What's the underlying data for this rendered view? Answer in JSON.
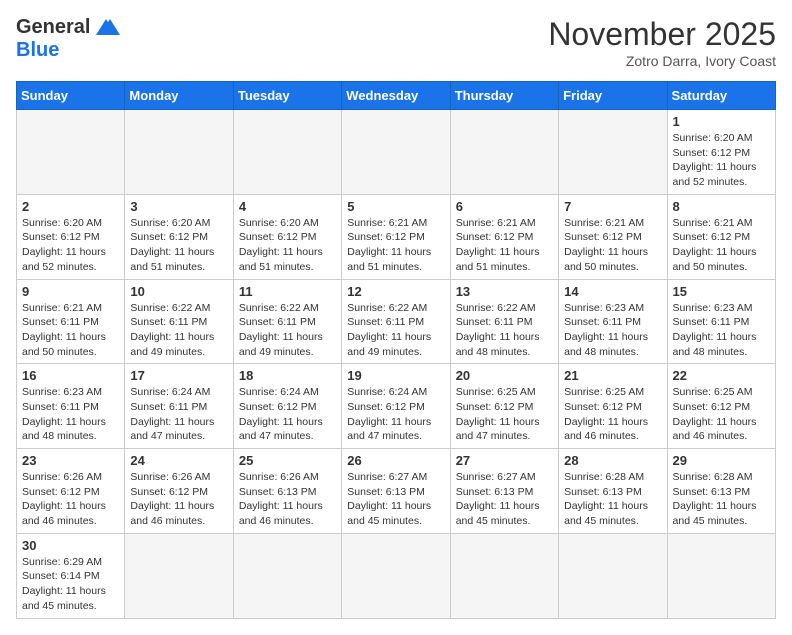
{
  "header": {
    "logo_general": "General",
    "logo_blue": "Blue",
    "month": "November 2025",
    "location": "Zotro Darra, Ivory Coast"
  },
  "days_of_week": [
    "Sunday",
    "Monday",
    "Tuesday",
    "Wednesday",
    "Thursday",
    "Friday",
    "Saturday"
  ],
  "weeks": [
    [
      {
        "day": "",
        "text": ""
      },
      {
        "day": "",
        "text": ""
      },
      {
        "day": "",
        "text": ""
      },
      {
        "day": "",
        "text": ""
      },
      {
        "day": "",
        "text": ""
      },
      {
        "day": "",
        "text": ""
      },
      {
        "day": "1",
        "text": "Sunrise: 6:20 AM\nSunset: 6:12 PM\nDaylight: 11 hours\nand 52 minutes."
      }
    ],
    [
      {
        "day": "2",
        "text": "Sunrise: 6:20 AM\nSunset: 6:12 PM\nDaylight: 11 hours\nand 52 minutes."
      },
      {
        "day": "3",
        "text": "Sunrise: 6:20 AM\nSunset: 6:12 PM\nDaylight: 11 hours\nand 51 minutes."
      },
      {
        "day": "4",
        "text": "Sunrise: 6:20 AM\nSunset: 6:12 PM\nDaylight: 11 hours\nand 51 minutes."
      },
      {
        "day": "5",
        "text": "Sunrise: 6:21 AM\nSunset: 6:12 PM\nDaylight: 11 hours\nand 51 minutes."
      },
      {
        "day": "6",
        "text": "Sunrise: 6:21 AM\nSunset: 6:12 PM\nDaylight: 11 hours\nand 51 minutes."
      },
      {
        "day": "7",
        "text": "Sunrise: 6:21 AM\nSunset: 6:12 PM\nDaylight: 11 hours\nand 50 minutes."
      },
      {
        "day": "8",
        "text": "Sunrise: 6:21 AM\nSunset: 6:12 PM\nDaylight: 11 hours\nand 50 minutes."
      }
    ],
    [
      {
        "day": "9",
        "text": "Sunrise: 6:21 AM\nSunset: 6:11 PM\nDaylight: 11 hours\nand 50 minutes."
      },
      {
        "day": "10",
        "text": "Sunrise: 6:22 AM\nSunset: 6:11 PM\nDaylight: 11 hours\nand 49 minutes."
      },
      {
        "day": "11",
        "text": "Sunrise: 6:22 AM\nSunset: 6:11 PM\nDaylight: 11 hours\nand 49 minutes."
      },
      {
        "day": "12",
        "text": "Sunrise: 6:22 AM\nSunset: 6:11 PM\nDaylight: 11 hours\nand 49 minutes."
      },
      {
        "day": "13",
        "text": "Sunrise: 6:22 AM\nSunset: 6:11 PM\nDaylight: 11 hours\nand 48 minutes."
      },
      {
        "day": "14",
        "text": "Sunrise: 6:23 AM\nSunset: 6:11 PM\nDaylight: 11 hours\nand 48 minutes."
      },
      {
        "day": "15",
        "text": "Sunrise: 6:23 AM\nSunset: 6:11 PM\nDaylight: 11 hours\nand 48 minutes."
      }
    ],
    [
      {
        "day": "16",
        "text": "Sunrise: 6:23 AM\nSunset: 6:11 PM\nDaylight: 11 hours\nand 48 minutes."
      },
      {
        "day": "17",
        "text": "Sunrise: 6:24 AM\nSunset: 6:11 PM\nDaylight: 11 hours\nand 47 minutes."
      },
      {
        "day": "18",
        "text": "Sunrise: 6:24 AM\nSunset: 6:12 PM\nDaylight: 11 hours\nand 47 minutes."
      },
      {
        "day": "19",
        "text": "Sunrise: 6:24 AM\nSunset: 6:12 PM\nDaylight: 11 hours\nand 47 minutes."
      },
      {
        "day": "20",
        "text": "Sunrise: 6:25 AM\nSunset: 6:12 PM\nDaylight: 11 hours\nand 47 minutes."
      },
      {
        "day": "21",
        "text": "Sunrise: 6:25 AM\nSunset: 6:12 PM\nDaylight: 11 hours\nand 46 minutes."
      },
      {
        "day": "22",
        "text": "Sunrise: 6:25 AM\nSunset: 6:12 PM\nDaylight: 11 hours\nand 46 minutes."
      }
    ],
    [
      {
        "day": "23",
        "text": "Sunrise: 6:26 AM\nSunset: 6:12 PM\nDaylight: 11 hours\nand 46 minutes."
      },
      {
        "day": "24",
        "text": "Sunrise: 6:26 AM\nSunset: 6:12 PM\nDaylight: 11 hours\nand 46 minutes."
      },
      {
        "day": "25",
        "text": "Sunrise: 6:26 AM\nSunset: 6:13 PM\nDaylight: 11 hours\nand 46 minutes."
      },
      {
        "day": "26",
        "text": "Sunrise: 6:27 AM\nSunset: 6:13 PM\nDaylight: 11 hours\nand 45 minutes."
      },
      {
        "day": "27",
        "text": "Sunrise: 6:27 AM\nSunset: 6:13 PM\nDaylight: 11 hours\nand 45 minutes."
      },
      {
        "day": "28",
        "text": "Sunrise: 6:28 AM\nSunset: 6:13 PM\nDaylight: 11 hours\nand 45 minutes."
      },
      {
        "day": "29",
        "text": "Sunrise: 6:28 AM\nSunset: 6:13 PM\nDaylight: 11 hours\nand 45 minutes."
      }
    ],
    [
      {
        "day": "30",
        "text": "Sunrise: 6:29 AM\nSunset: 6:14 PM\nDaylight: 11 hours\nand 45 minutes."
      },
      {
        "day": "",
        "text": ""
      },
      {
        "day": "",
        "text": ""
      },
      {
        "day": "",
        "text": ""
      },
      {
        "day": "",
        "text": ""
      },
      {
        "day": "",
        "text": ""
      },
      {
        "day": "",
        "text": ""
      }
    ]
  ]
}
